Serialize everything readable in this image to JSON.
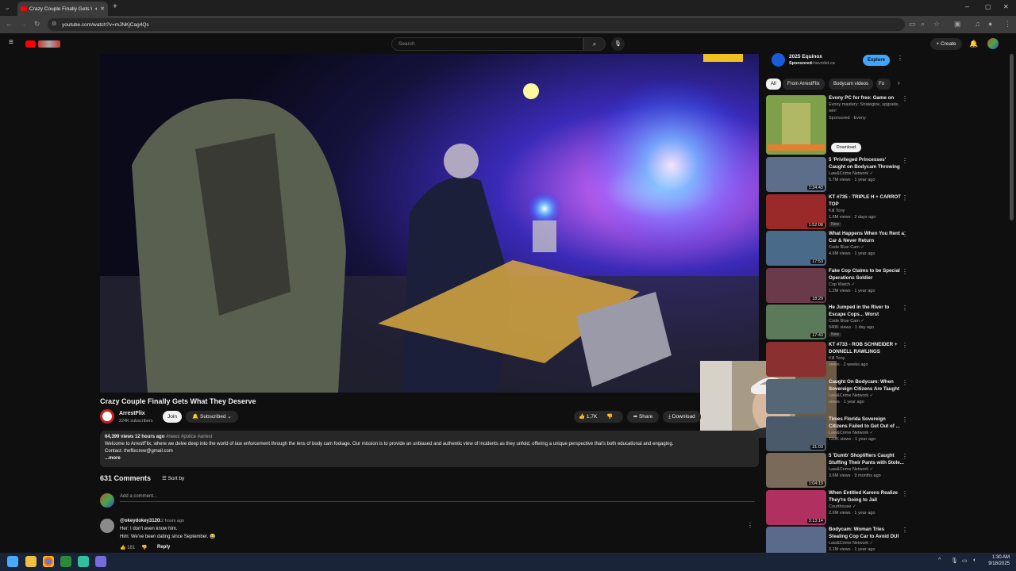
{
  "browser": {
    "tab_title": "Crazy Couple Finally Gets W",
    "url": "youtube.com/watch?v=mJNKjCag4Qs"
  },
  "youtube": {
    "search_placeholder": "Search",
    "create_label": "+ Create"
  },
  "video": {
    "title": "Crazy Couple Finally Gets What They Deserve",
    "channel": "ArrestFlix",
    "subscribers": "224K subscribers",
    "join_label": "Join",
    "subscribed_label": "Subscribed",
    "likes": "1.7K",
    "share_label": "Share",
    "download_label": "Download",
    "views_time": "64,399 views  12 hours ago",
    "hashtags": "#news #police #arrest",
    "description": "Welcome to ArrestFlix, where we delve deep into the world of law enforcement through the lens of body cam footage. Our mission is to provide an unbiased and authentic view of incidents as they unfold, offering a unique perspective that's both educational and engaging.",
    "contact": "Contact: theflixcrew@gmail.com",
    "more_label": "...more"
  },
  "comments": {
    "count_label": "631 Comments",
    "sort_label": "Sort by",
    "add_placeholder": "Add a comment...",
    "first": {
      "author": "@okeydokey3120",
      "time": "12 hours ago",
      "line1": "Her: I don't even know him.",
      "line2": "Him: We've been dating since September. 😂",
      "likes": "181",
      "reply_label": "Reply"
    }
  },
  "ad": {
    "title": "2025 Equinox",
    "sponsored": "Sponsored",
    "domain": "chevrolet.ca",
    "cta": "Explore"
  },
  "chips": [
    "All",
    "From ArrestFlix",
    "Bodycam videos",
    "Fo"
  ],
  "recommendations": [
    {
      "title": "Evony PC for free: Game on",
      "channel": "Evony mastery: Strategize, upgrade, win!",
      "meta": "Sponsored · Evony",
      "duration": "",
      "badge": "",
      "cta": "Download",
      "color": "#7fa04a"
    },
    {
      "title": "5 'Privileged Princesses' Caught on Bodycam Throwing Fits wit...",
      "channel": "Law&Crime Network ✓",
      "meta": "5.7M views · 1 year ago",
      "duration": "1:34:43",
      "badge": "",
      "color": "#5d6e8a"
    },
    {
      "title": "KT #735 - TRIPLE H + CARROT TOP",
      "channel": "Kill Tony",
      "meta": "1.6M views · 2 days ago",
      "duration": "1:52:08",
      "badge": "New",
      "color": "#9a2a2a"
    },
    {
      "title": "What Happens When You Rent a Car & Never Return",
      "channel": "Code Blue Cam ✓",
      "meta": "4.6M views · 1 year ago",
      "duration": "17:53",
      "badge": "",
      "color": "#4a6a8a"
    },
    {
      "title": "Fake Cop Claims to be Special Operations Soldier",
      "channel": "Cop Watch ✓",
      "meta": "1.2M views · 1 year ago",
      "duration": "18:29",
      "badge": "",
      "color": "#6a3a4a"
    },
    {
      "title": "He Jumped in the River to Escape Cops... Worst Decision...",
      "channel": "Code Blue Cam ✓",
      "meta": "540K views · 1 day ago",
      "duration": "17:43",
      "badge": "New",
      "color": "#5a7a5a"
    },
    {
      "title": "KT #733 - ROB SCHNEIDER + DONNELL RAWLINGS",
      "channel": "Kill Tony",
      "meta": "views · 2 weeks ago",
      "duration": "",
      "badge": "",
      "color": "#8a3030"
    },
    {
      "title": "Caught On Bodycam: When Sovereign Citizens Are Taught ...",
      "channel": "Law&Crime Network ✓",
      "meta": "views · 1 year ago",
      "duration": "",
      "badge": "",
      "color": "#556677"
    },
    {
      "title": "Times Florida Sovereign Citizens Failed to Get Out of ...",
      "channel": "Law&Crime Network ✓",
      "meta": "720K views · 1 year ago",
      "duration": "31:03",
      "badge": "",
      "color": "#4a5a6a"
    },
    {
      "title": "5 'Dumb' Shoplifters Caught Stuffing Their Pants with Stole...",
      "channel": "Law&Crime Network ✓",
      "meta": "3.6M views · 9 months ago",
      "duration": "1:04:19",
      "badge": "",
      "color": "#7a6a5a"
    },
    {
      "title": "When Entitled Karens Realize They're Going to Jail",
      "channel": "Courthouse ✓",
      "meta": "2.6M views · 1 year ago",
      "duration": "3:13:14",
      "badge": "",
      "color": "#b03060"
    },
    {
      "title": "Bodycam: Woman Tries Stealing Cop Car to Avoid DUI ...",
      "channel": "Law&Crime Network ✓",
      "meta": "3.1M views · 1 year ago",
      "duration": "",
      "badge": "",
      "color": "#5a6a8a"
    }
  ],
  "system": {
    "time": "1:30 AM",
    "date": "9/18/2025"
  }
}
